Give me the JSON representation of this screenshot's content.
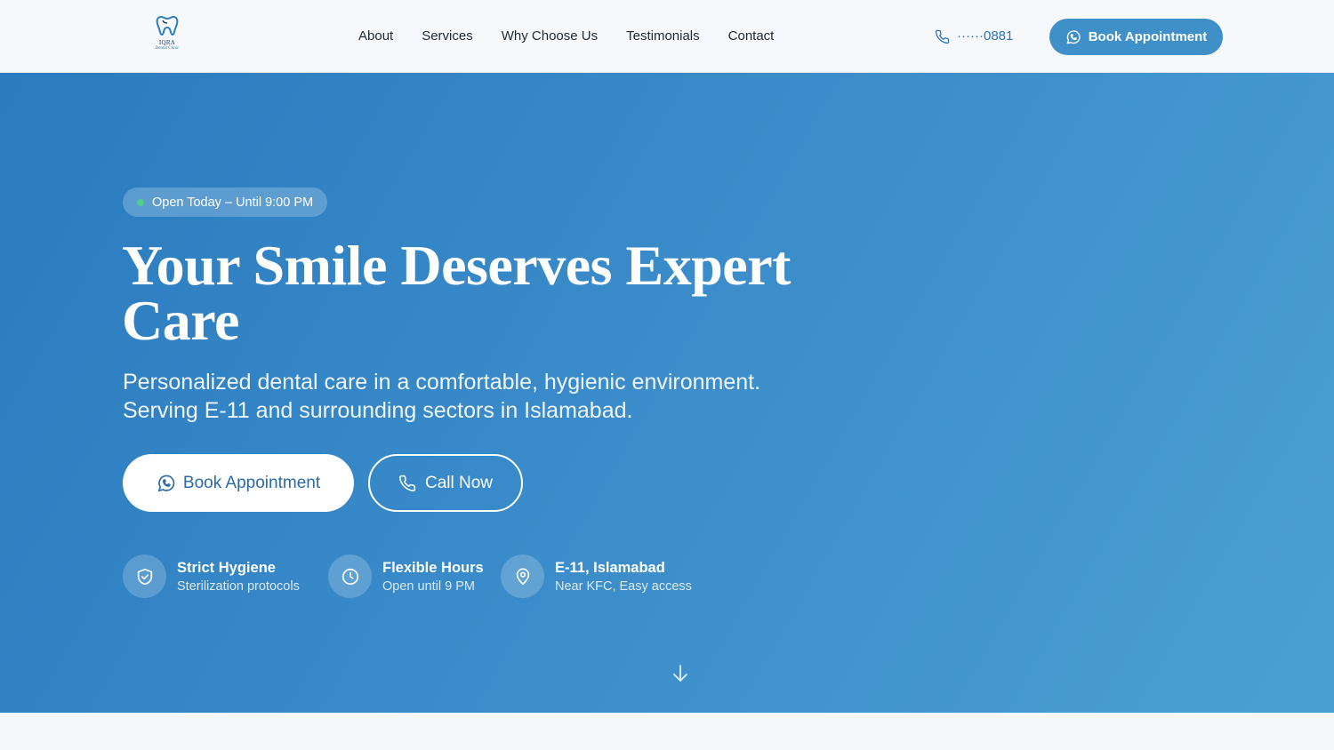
{
  "header": {
    "logo": {
      "name": "IQRA",
      "subtitle": "Dental Clinic"
    },
    "nav": [
      {
        "label": "About"
      },
      {
        "label": "Services"
      },
      {
        "label": "Why Choose Us"
      },
      {
        "label": "Testimonials"
      },
      {
        "label": "Contact"
      }
    ],
    "phone": "······0881",
    "cta_label": "Book Appointment"
  },
  "hero": {
    "badge": "Open Today – Until 9:00 PM",
    "title": "Your Smile Deserves Expert Care",
    "subtitle_line1": "Personalized dental care in a comfortable, hygienic environment.",
    "subtitle_line2": "Serving E-11 and surrounding sectors in Islamabad.",
    "primary_button": "Book Appointment",
    "secondary_button": "Call Now",
    "features": [
      {
        "title": "Strict Hygiene",
        "desc": "Sterilization protocols",
        "icon": "shield-check-icon"
      },
      {
        "title": "Flexible Hours",
        "desc": "Open until 9 PM",
        "icon": "clock-icon"
      },
      {
        "title": "E-11, Islamabad",
        "desc": "Near KFC, Easy access",
        "icon": "map-pin-icon"
      }
    ]
  },
  "colors": {
    "brand": "#2e73b4",
    "cta": "#3f8fc9",
    "hero_start": "#2a7bbf",
    "hero_end": "#4aa0d3",
    "status_dot": "#4ccf8a"
  }
}
